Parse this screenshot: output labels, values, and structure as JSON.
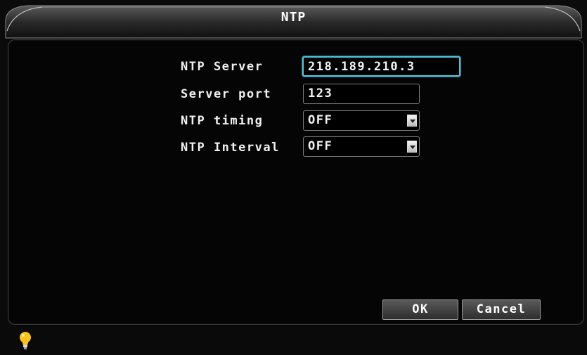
{
  "window": {
    "title": "NTP"
  },
  "form": {
    "ntp_server": {
      "label": "NTP Server",
      "value": "218.189.210.3"
    },
    "server_port": {
      "label": "Server port",
      "value": "123"
    },
    "ntp_timing": {
      "label": "NTP timing",
      "value": "OFF"
    },
    "ntp_interval": {
      "label": "NTP Interval",
      "value": "OFF"
    }
  },
  "buttons": {
    "ok": "OK",
    "cancel": "Cancel"
  },
  "icons": {
    "status": "lightbulb-icon"
  },
  "colors": {
    "focus": "#4fc3d6",
    "bulb": "#ffc21a"
  }
}
